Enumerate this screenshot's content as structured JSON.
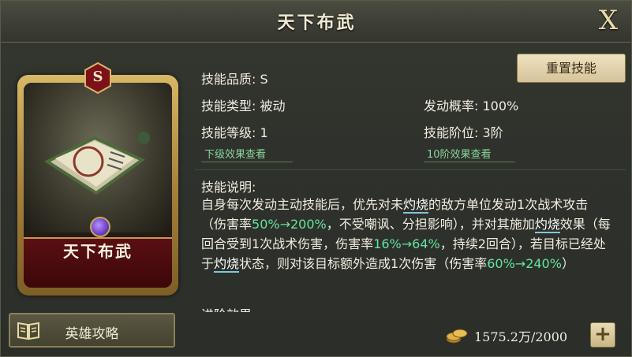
{
  "dialog": {
    "title": "天下布武",
    "close_label": "X"
  },
  "card": {
    "rank": "S",
    "name": "天下布武"
  },
  "guide_button": {
    "label": "英雄攻略"
  },
  "reset_button": {
    "label": "重置技能"
  },
  "info": {
    "quality": "技能品质: S",
    "type": "技能类型: 被动",
    "trigger_rate": "发动概率: 100%",
    "level": "技能等级: 1",
    "tier": "技能阶位: 3阶",
    "next_level_link": "下级效果查看",
    "tier10_link": "10阶效果查看"
  },
  "description": {
    "title": "技能说明:",
    "parts": [
      {
        "t": "自身每次发动主动技能后，优先对未",
        "c": ""
      },
      {
        "t": "灼烧",
        "c": "kw"
      },
      {
        "t": "的敌方单位发动1次战术攻击（伤害率",
        "c": ""
      },
      {
        "t": "50%→200%",
        "c": "hl"
      },
      {
        "t": "，不受嘲讽、分担影响），并对其施加",
        "c": ""
      },
      {
        "t": "灼烧",
        "c": "kw"
      },
      {
        "t": "效果（每回合受到1次战术伤害，伤害率",
        "c": ""
      },
      {
        "t": "16%→64%",
        "c": "hl"
      },
      {
        "t": "，持续2回合），若目标已经处于",
        "c": ""
      },
      {
        "t": "灼烧",
        "c": "kw"
      },
      {
        "t": "状态，则对该目标额外造成1次伤害（伤害率",
        "c": ""
      },
      {
        "t": "60%→240%",
        "c": "hl"
      },
      {
        "t": "）",
        "c": ""
      }
    ],
    "advanced_title": "进阶效果:"
  },
  "currency": {
    "amount": "1575.2万/2000",
    "plus_label": "+"
  },
  "colors": {
    "highlight": "#66e3a0",
    "link": "#89d49b",
    "gold": "#c9a65b",
    "nameplate": "#5a0f12"
  },
  "icons": [
    "close-icon",
    "rank-badge-icon",
    "book-icon",
    "coin-icon",
    "plus-icon",
    "gem-icon"
  ]
}
